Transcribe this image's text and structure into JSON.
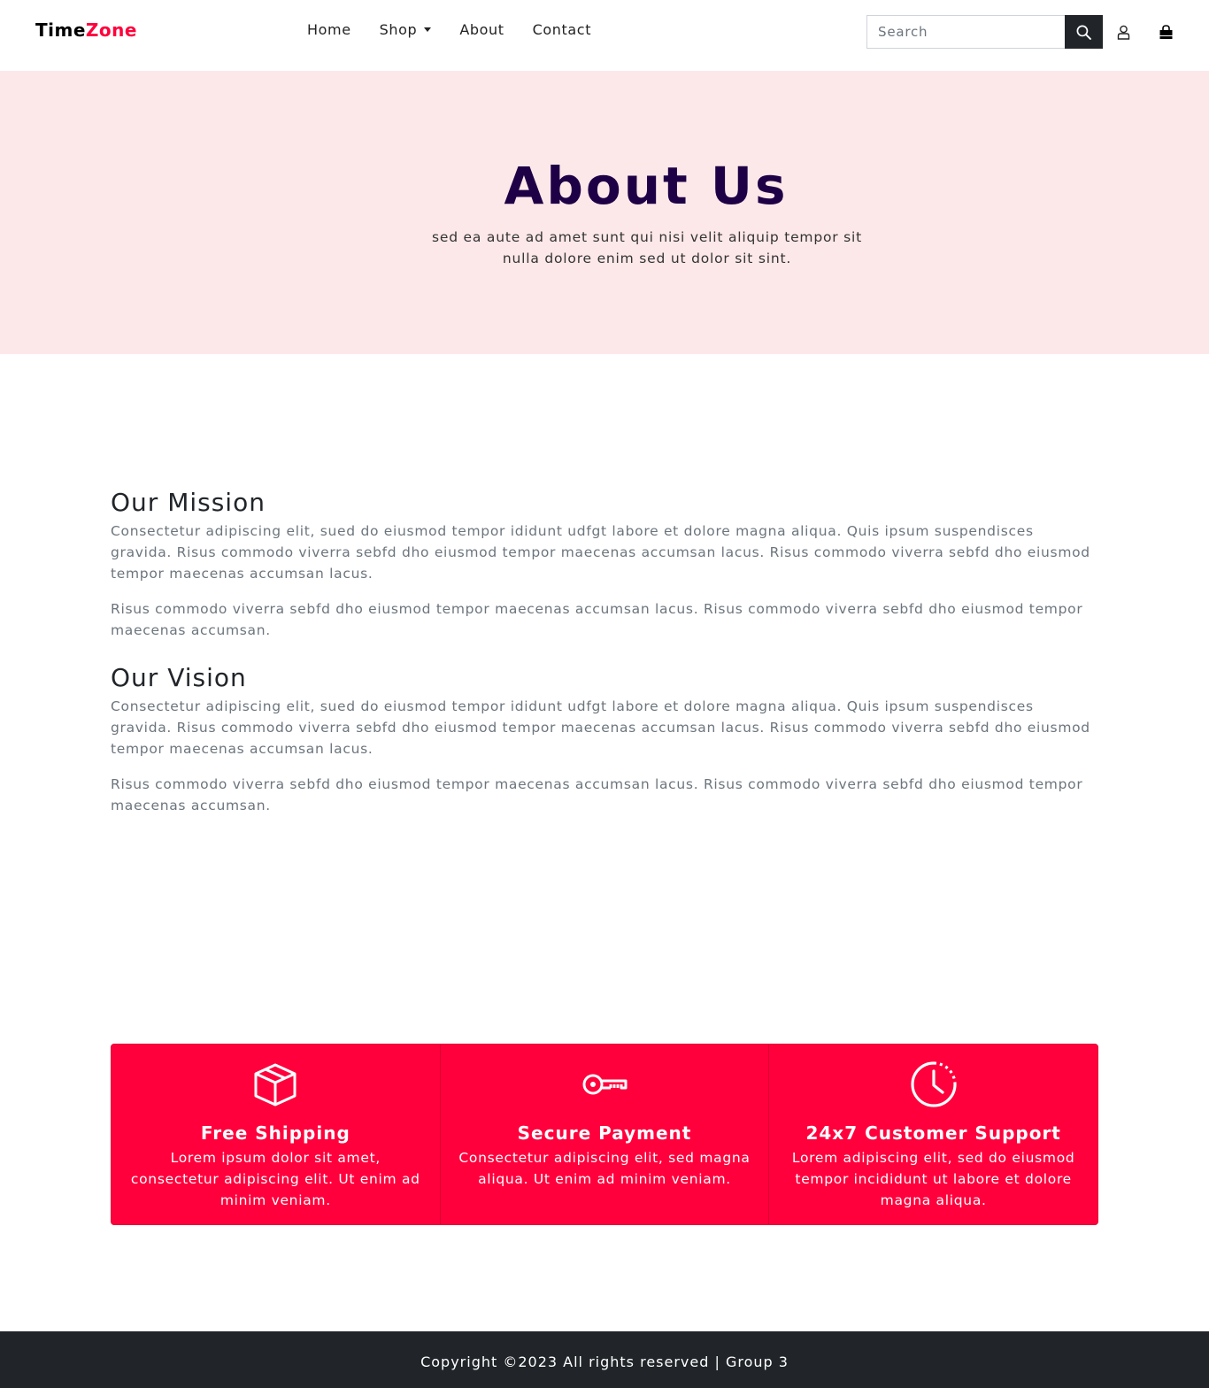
{
  "brand": {
    "part1": "Time",
    "part2": "Zone"
  },
  "nav": {
    "items": [
      {
        "label": "Home"
      },
      {
        "label": "Shop"
      },
      {
        "label": "About"
      },
      {
        "label": "Contact"
      }
    ]
  },
  "search": {
    "placeholder": "Search",
    "value": ""
  },
  "icons": {
    "search": "search-icon",
    "account": "user-icon",
    "cart": "shopping-bag-icon"
  },
  "hero": {
    "title": "About Us",
    "subtitle": "sed ea aute ad amet sunt qui nisi velit aliquip tempor sit nulla dolore enim sed ut dolor sit sint."
  },
  "mission": {
    "title": "Our Mission",
    "p1": "Consectetur adipiscing elit, sued do eiusmod tempor ididunt udfgt labore et dolore magna aliqua. Quis ipsum suspendisces gravida. Risus commodo viverra sebfd dho eiusmod tempor maecenas accumsan lacus. Risus commodo viverra sebfd dho eiusmod tempor maecenas accumsan lacus.",
    "p2": "Risus commodo viverra sebfd dho eiusmod tempor maecenas accumsan lacus. Risus commodo viverra sebfd dho eiusmod tempor maecenas accumsan."
  },
  "vision": {
    "title": "Our Vision",
    "p1": "Consectetur adipiscing elit, sued do eiusmod tempor ididunt udfgt labore et dolore magna aliqua. Quis ipsum suspendisces gravida. Risus commodo viverra sebfd dho eiusmod tempor maecenas accumsan lacus. Risus commodo viverra sebfd dho eiusmod tempor maecenas accumsan lacus.",
    "p2": "Risus commodo viverra sebfd dho eiusmod tempor maecenas accumsan lacus. Risus commodo viverra sebfd dho eiusmod tempor maecenas accumsan."
  },
  "features": [
    {
      "icon": "box-icon",
      "title": "Free Shipping",
      "text": "Lorem ipsum dolor sit amet, consectetur adipiscing elit. Ut enim ad minim veniam."
    },
    {
      "icon": "key-icon",
      "title": "Secure Payment",
      "text": "Consectetur adipiscing elit, sed magna aliqua. Ut enim ad minim veniam."
    },
    {
      "icon": "clock-icon",
      "title": "24x7 Customer Support",
      "text": "Lorem adipiscing elit, sed do eiusmod tempor incididunt ut labore et dolore magna aliqua."
    }
  ],
  "footer": {
    "text": "Copyright ©2023 All rights reserved | Group 3"
  },
  "colors": {
    "accent": "#ff003c",
    "hero_bg": "#fde8e9",
    "hero_title": "#1e0046",
    "footer_bg": "#212529"
  }
}
